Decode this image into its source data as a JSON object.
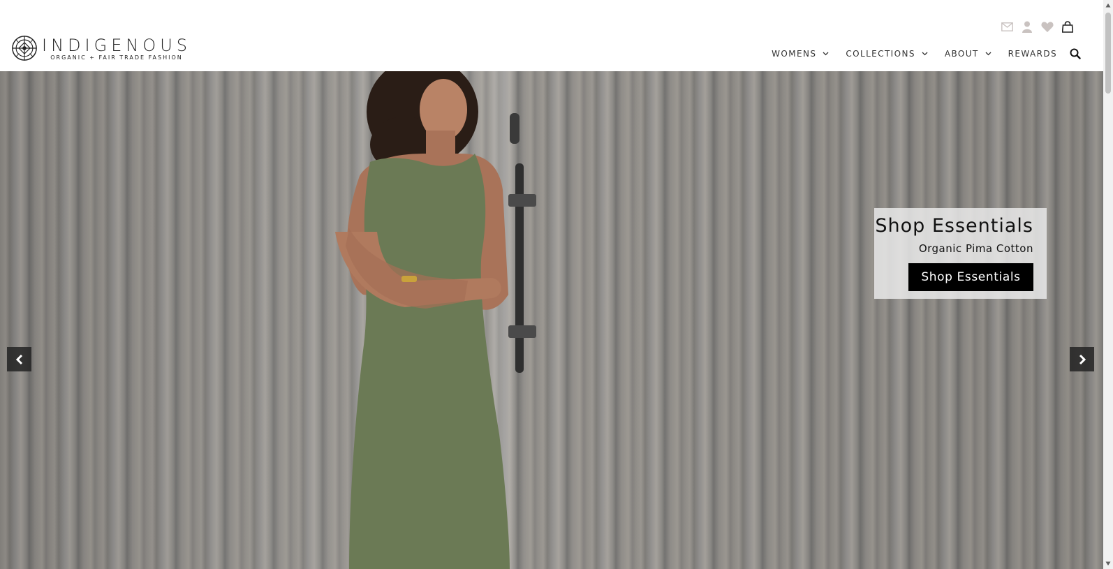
{
  "brand": {
    "name": "INDIGENOUS",
    "tagline": "ORGANIC + FAIR TRADE FASHION"
  },
  "utility_icons": [
    "mail-icon",
    "account-icon",
    "wishlist-heart-icon",
    "shopping-bag-icon"
  ],
  "nav": {
    "items": [
      {
        "label": "WOMENS",
        "has_dropdown": true
      },
      {
        "label": "COLLECTIONS",
        "has_dropdown": true
      },
      {
        "label": "ABOUT",
        "has_dropdown": true
      },
      {
        "label": "REWARDS",
        "has_dropdown": false
      }
    ],
    "search_icon": "search-icon"
  },
  "hero": {
    "promo": {
      "title": "Shop Essentials",
      "subtitle": "Organic Pima Cotton",
      "button_label": "Shop Essentials"
    },
    "prev_icon": "chevron-left-icon",
    "next_icon": "chevron-right-icon"
  },
  "colors": {
    "button_bg": "#000000",
    "dress_green": "#6b7a55",
    "promo_panel": "#ebebeb",
    "utility_icon": "#c9c2c0"
  }
}
